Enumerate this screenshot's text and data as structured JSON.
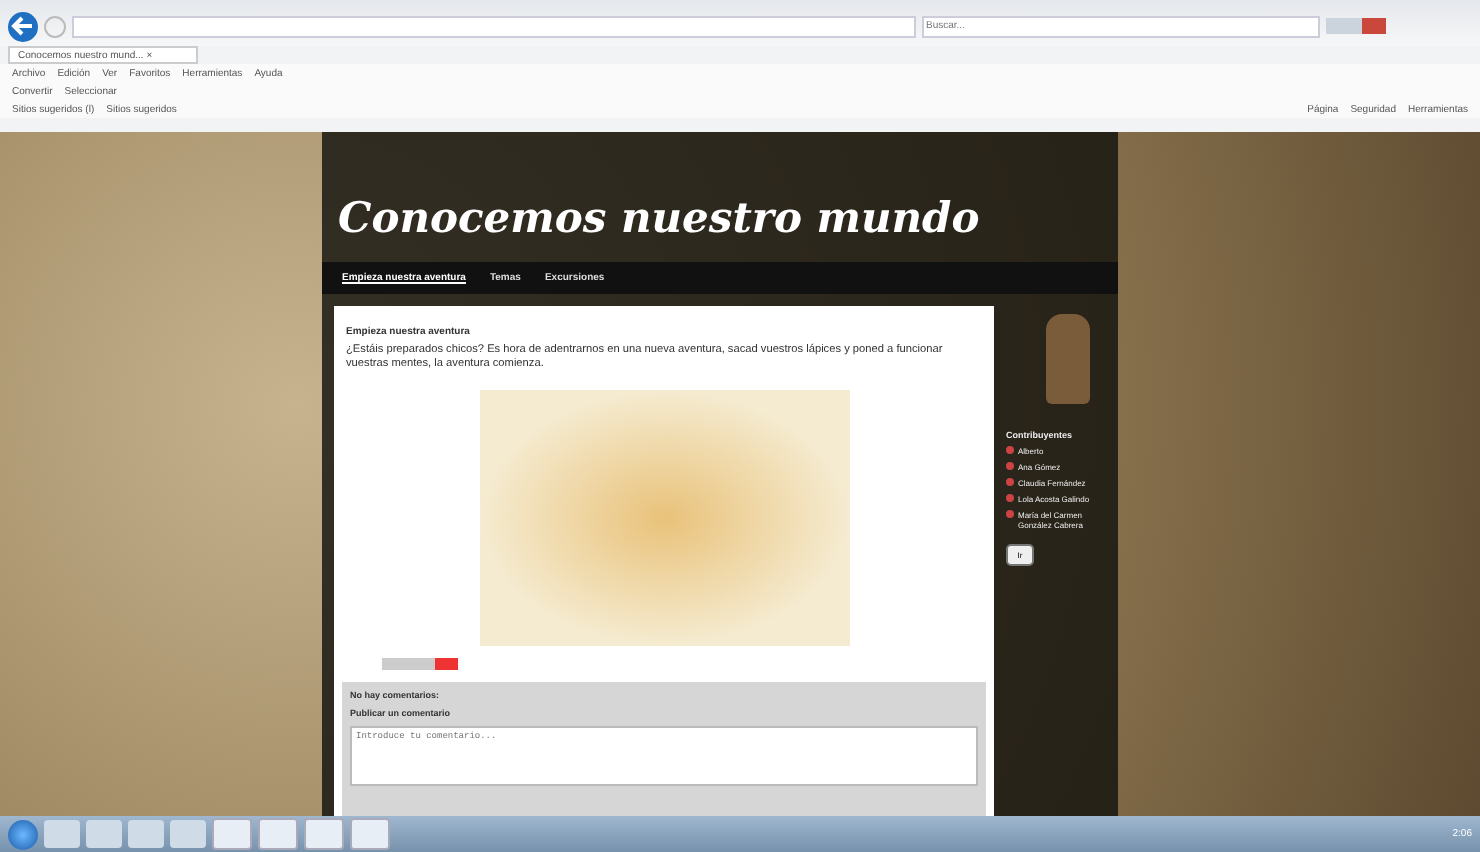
{
  "browser": {
    "search_placeholder": "Buscar...",
    "tab": {
      "title": "Conocemos nuestro mund...",
      "close": "×"
    },
    "menu": [
      "Archivo",
      "Edición",
      "Ver",
      "Favoritos",
      "Herramientas",
      "Ayuda"
    ],
    "command_bar": [
      "Convertir",
      "Seleccionar"
    ],
    "favorites": [
      "Sitios sugeridos (l)",
      "Sitios sugeridos"
    ],
    "tools": [
      "Página",
      "Seguridad",
      "Herramientas"
    ]
  },
  "blog": {
    "title": "Conocemos nuestro mundo",
    "nav": [
      {
        "label": "Empieza nuestra aventura",
        "selected": true
      },
      {
        "label": "Temas",
        "selected": false
      },
      {
        "label": "Excursiones",
        "selected": false
      }
    ],
    "post": {
      "title": "Empieza nuestra aventura",
      "body": "¿Estáis preparados chicos? Es hora de adentrarnos en una nueva aventura, sacad vuestros lápices y poned a funcionar vuestras mentes, la aventura comienza."
    },
    "comments": {
      "count": "No hay comentarios:",
      "heading": "Publicar un comentario",
      "placeholder": "Introduce tu comentario..."
    },
    "sidebar": {
      "heading": "Contribuyentes",
      "contributors": [
        "Alberto",
        "Ana Gómez",
        "Claudia Fernández",
        "Lola Acosta Galindo",
        "María del Carmen González Cabrera"
      ],
      "button": "Ir"
    }
  },
  "taskbar": {
    "clock": "2:06"
  }
}
